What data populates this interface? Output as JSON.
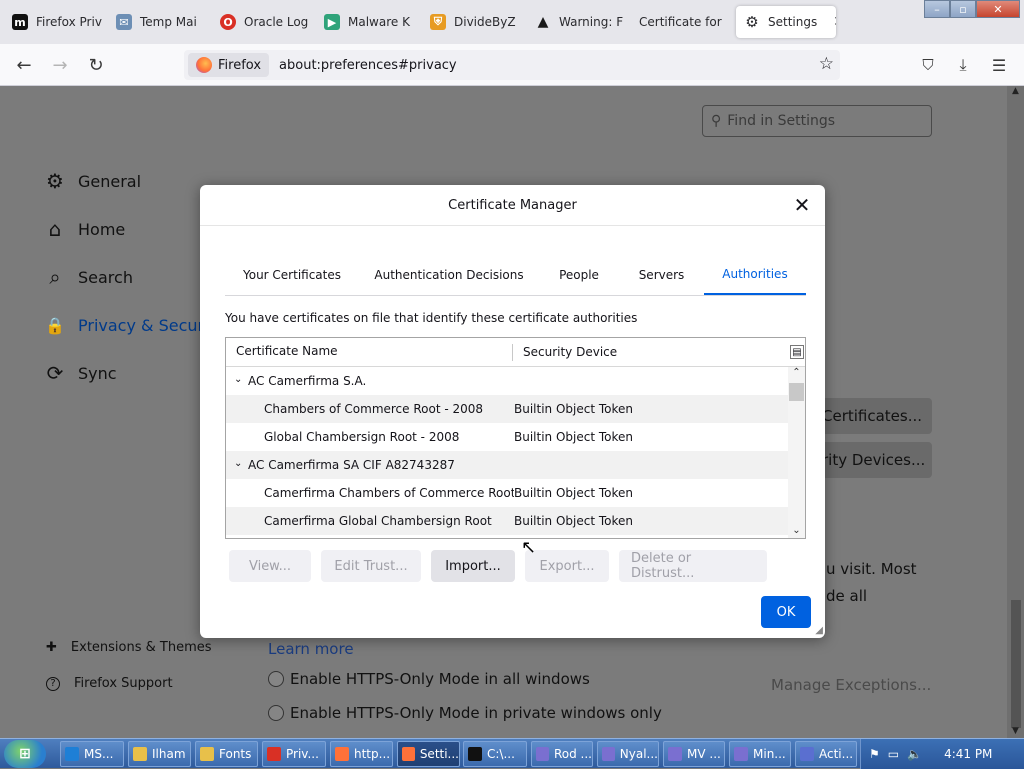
{
  "tabs": [
    {
      "label": "Firefox Priv",
      "icon": "m-logo-icon",
      "color": "#111111",
      "glyph": "m"
    },
    {
      "label": "Temp Mai",
      "icon": "mail-icon",
      "color": "#6d8fb5",
      "glyph": "✉"
    },
    {
      "label": "Oracle Log",
      "icon": "oracle-icon",
      "color": "#d93025",
      "glyph": "O"
    },
    {
      "label": "Malware K",
      "icon": "play-icon",
      "color": "#2fa37a",
      "glyph": "▶"
    },
    {
      "label": "DivideByZ",
      "icon": "shield-icon",
      "color": "#e79b22",
      "glyph": "⛨"
    },
    {
      "label": "Warning: F",
      "icon": "warning-icon",
      "color": "#1a1a1a",
      "glyph": "▲"
    },
    {
      "label": "Certificate for",
      "icon": "",
      "color": "",
      "glyph": ""
    },
    {
      "label": "Settings",
      "icon": "gear-icon",
      "color": "",
      "glyph": "⚙"
    }
  ],
  "navbar": {
    "identity_label": "Firefox",
    "url": "about:preferences#privacy"
  },
  "prefs": {
    "find_placeholder": "Find in Settings",
    "categories": [
      {
        "label": "General",
        "glyph": "⚙"
      },
      {
        "label": "Home",
        "glyph": "⌂"
      },
      {
        "label": "Search",
        "glyph": "⌕"
      },
      {
        "label": "Privacy & Security",
        "glyph": "🔒"
      },
      {
        "label": "Sync",
        "glyph": "⟳"
      }
    ],
    "footer": [
      {
        "label": "Extensions & Themes",
        "glyph": "✚"
      },
      {
        "label": "Firefox Support",
        "glyph": "?"
      }
    ],
    "bg_certificates_btn": "Certificates...",
    "bg_devices_btn": "rity Devices...",
    "bg_text_1": "u visit. Most",
    "bg_text_2": "de all",
    "learn_more": "Learn more",
    "radio_1": "Enable HTTPS-Only Mode in all windows",
    "radio_2": "Enable HTTPS-Only Mode in private windows only",
    "manage_exceptions": "Manage Exceptions..."
  },
  "dialog": {
    "title": "Certificate Manager",
    "tabs": [
      "Your Certificates",
      "Authentication Decisions",
      "People",
      "Servers",
      "Authorities"
    ],
    "active_tab": "Authorities",
    "intro": "You have certificates on file that identify these certificate authorities",
    "columns": {
      "name": "Certificate Name",
      "device": "Security Device"
    },
    "rows": [
      {
        "name": "AC Camerfirma S.A.",
        "device": "",
        "group": true
      },
      {
        "name": "Chambers of Commerce Root - 2008",
        "device": "Builtin Object Token",
        "group": false
      },
      {
        "name": "Global Chambersign Root - 2008",
        "device": "Builtin Object Token",
        "group": false
      },
      {
        "name": "AC Camerfirma SA CIF A82743287",
        "device": "",
        "group": true
      },
      {
        "name": "Camerfirma Chambers of Commerce Root",
        "device": "Builtin Object Token",
        "group": false
      },
      {
        "name": "Camerfirma Global Chambersign Root",
        "device": "Builtin Object Token",
        "group": false
      }
    ],
    "buttons": {
      "view": "View...",
      "edit_trust": "Edit Trust...",
      "import": "Import...",
      "export": "Export...",
      "delete": "Delete or Distrust..."
    },
    "ok": "OK"
  },
  "taskbar": {
    "items": [
      {
        "label": "MS...",
        "icon": "ie-icon",
        "color": "#1e7fd6"
      },
      {
        "label": "Ilham",
        "icon": "folder-icon",
        "color": "#e8c04a"
      },
      {
        "label": "Fonts",
        "icon": "folder-icon",
        "color": "#e8c04a"
      },
      {
        "label": "Priv...",
        "icon": "chrome-icon",
        "color": "#d93025"
      },
      {
        "label": "http...",
        "icon": "firefox-icon",
        "color": "#ff7139"
      },
      {
        "label": "Setti...",
        "icon": "firefox-icon",
        "color": "#ff7139"
      },
      {
        "label": "C:\\...",
        "icon": "cmd-icon",
        "color": "#111111"
      },
      {
        "label": "Rod ...",
        "icon": "app-icon",
        "color": "#7a6fd0"
      },
      {
        "label": "Nyal...",
        "icon": "app-icon",
        "color": "#7a6fd0"
      },
      {
        "label": "MV ...",
        "icon": "app-icon",
        "color": "#7a6fd0"
      },
      {
        "label": "Min...",
        "icon": "app-icon",
        "color": "#7a6fd0"
      },
      {
        "label": "Acti...",
        "icon": "flag-icon",
        "color": "#5a6fd0"
      }
    ],
    "clock": "4:41 PM"
  },
  "colors": {
    "accent": "#0061e0"
  }
}
